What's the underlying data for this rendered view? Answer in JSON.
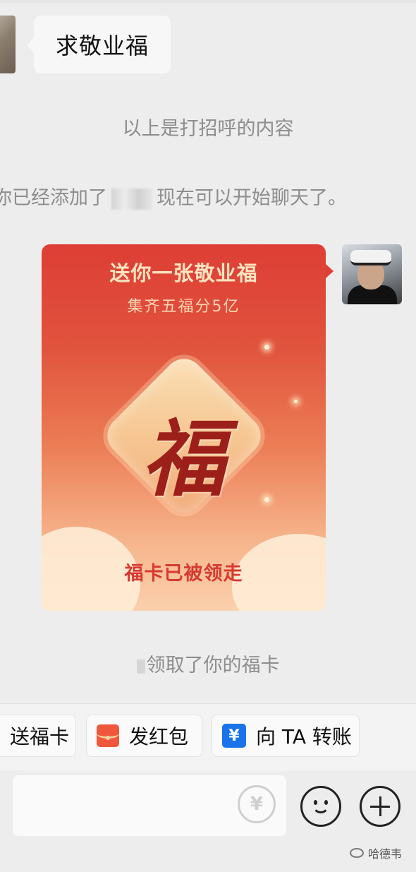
{
  "messages": {
    "incoming_text": "求敬业福",
    "system_1": "以上是打招呼的内容",
    "system_2_prefix": "你已经添加了",
    "system_2_suffix": "现在可以开始聊天了。",
    "system_3": "领取了你的福卡"
  },
  "card": {
    "title": "送你一张敬业福",
    "subtitle": "集齐五福分5亿",
    "character": "福",
    "status": "福卡已被领走"
  },
  "action_bar": {
    "send_fuka": "送福卡",
    "red_packet": "发红包",
    "transfer": "向 TA 转账",
    "transfer_icon": "¥"
  },
  "input": {
    "yuan_icon": "¥"
  },
  "watermark": {
    "text": "哈德韦"
  },
  "colors": {
    "card_top": "#de3e35",
    "card_bottom": "#fbd0ad",
    "red_packet_icon": "#f0583c",
    "transfer_icon": "#1a73e8"
  }
}
